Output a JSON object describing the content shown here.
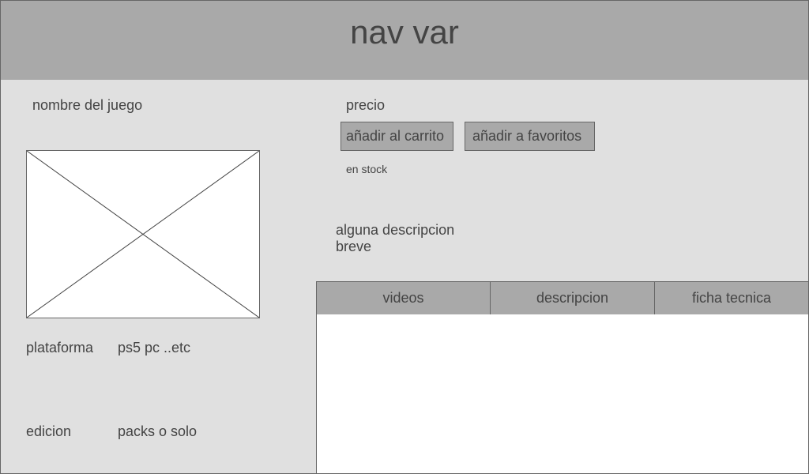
{
  "navbar": {
    "title": "nav var"
  },
  "product": {
    "name": "nombre del juego",
    "image_icon": "image-placeholder-icon",
    "platform_label": "plataforma",
    "platform_value": "ps5 pc ..etc",
    "edition_label": "edicion",
    "edition_value": "packs o solo"
  },
  "purchase": {
    "price": "precio",
    "add_to_cart": "añadir al carrito",
    "add_to_favorites": "añadir a favoritos",
    "stock": "en stock",
    "short_description": "alguna descripcion breve"
  },
  "tabs": [
    {
      "label": "videos"
    },
    {
      "label": "descripcion"
    },
    {
      "label": "ficha tecnica"
    }
  ],
  "colors": {
    "bar": "#a9a9a9",
    "panel": "#e0e0e0",
    "border": "#666666",
    "text": "#444444"
  }
}
